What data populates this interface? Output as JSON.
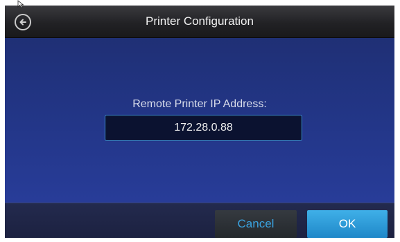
{
  "header": {
    "title": "Printer Configuration",
    "back_icon": "back-arrow-icon"
  },
  "main": {
    "field_label": "Remote Printer IP Address:",
    "ip_value": "172.28.0.88"
  },
  "footer": {
    "cancel_label": "Cancel",
    "ok_label": "OK"
  },
  "colors": {
    "accent": "#3aa3e0",
    "ok_button": "#2a9ad8",
    "background": "#2a3fa0"
  }
}
